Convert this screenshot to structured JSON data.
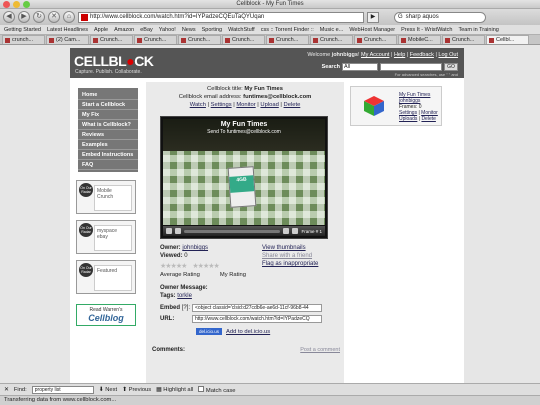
{
  "window": {
    "title": "Cellblock - My Fun Times"
  },
  "toolbar": {
    "url": "http://www.cellblock.com/watch.htm?id=IYPadzeCQEuTaQYUqan",
    "search_value": "sharp aquos"
  },
  "bookmarks": [
    "Getting Started",
    "Latest Headlines",
    "Apple",
    "Amazon",
    "eBay",
    "Yahoo!",
    "News",
    "Sporting",
    "WatchStuff",
    "css :: Torrent Finder ::",
    "Music e...",
    "WebHost Manager",
    "Press It - WristWatch",
    "Team in Training"
  ],
  "tabs": [
    "crunch...",
    "(2) Cam...",
    "Crunch...",
    "Crunch...",
    "Crunch...",
    "Crunch...",
    "Crunch...",
    "Crunch...",
    "Crunch...",
    "MobileC...",
    "Crunch...",
    "Cellbl..."
  ],
  "site": {
    "logo_text": "CELLBL",
    "logo_tail": "CK",
    "tagline": "Capture. Publish. Collaborate.",
    "welcome_prefix": "Welcome",
    "username": "johnbiggs",
    "account_links": [
      "My Account",
      "Help",
      "Feedback",
      "Log Out"
    ],
    "search_label": "Search",
    "search_scope": "All",
    "go_label": "GO",
    "search_note": "For advanced searches, use \" \" and"
  },
  "leftnav": [
    "Home",
    "Start a Cellblock",
    "My Fix",
    "What is Cellblock?",
    "Reviews",
    "Examples",
    "Embed Instructions",
    "FAQ"
  ],
  "badges": [
    {
      "stamp": "On Our Radar",
      "thumb": "Mobile Crunch"
    },
    {
      "stamp": "On Our Radar",
      "thumb": "myspace ebay"
    },
    {
      "stamp": "On Our Radar",
      "thumb": "Featured"
    }
  ],
  "blog_badge": {
    "line1": "Read Warren's",
    "line2": "Cellblog"
  },
  "cellblock": {
    "title_label": "Cellblock title:",
    "title": "My Fun Times",
    "email_label": "Cellblock email address:",
    "email": "funtimes@cellblock.com",
    "actions": [
      "Watch",
      "Settings",
      "Monitor",
      "Upload",
      "Delete"
    ]
  },
  "player": {
    "video_title": "My Fun Times",
    "video_sub": "Send To funtimes@cellblock.com",
    "carton_label": "4GB",
    "frame_label": "Frame # 1"
  },
  "meta": {
    "owner_label": "Owner:",
    "owner": "johnbiggs",
    "viewed_label": "Viewed:",
    "viewed": "0",
    "avg_rating_label": "Average Rating",
    "my_rating_label": "My Rating",
    "owner_message_label": "Owner Message:",
    "tags_label": "Tags:",
    "tags": "torkle",
    "view_thumbnails": "View thumbnails",
    "share_friend": "Share with a friend",
    "flag": "Flag as inappropriate"
  },
  "embed": {
    "embed_label": "Embed",
    "embed_hint": "[?]:",
    "embed_code": "<object classid='clsid:d27cdb6e-ae6d-11cf-96b8-44",
    "url_label": "URL:",
    "url_value": "http://www.cellblock.com/watch.htm?id=IYPadzeCQ",
    "delicious_badge": "del.icio.us",
    "delicious_link": "Add to del.icio.us"
  },
  "comments": {
    "label": "Comments:",
    "post": "Post a comment"
  },
  "right_panel": {
    "title": "My Fun Times",
    "owner": "johnbiggs",
    "frames": "Frames: 0",
    "links": [
      "Settings",
      "Monitor",
      "Uploads",
      "Delete"
    ]
  },
  "findbar": {
    "label": "Find:",
    "value": "property list",
    "next": "Next",
    "previous": "Previous",
    "highlight": "Highlight all",
    "match_case": "Match case"
  },
  "status": {
    "text": "Transferring data from www.cellblock.com..."
  }
}
